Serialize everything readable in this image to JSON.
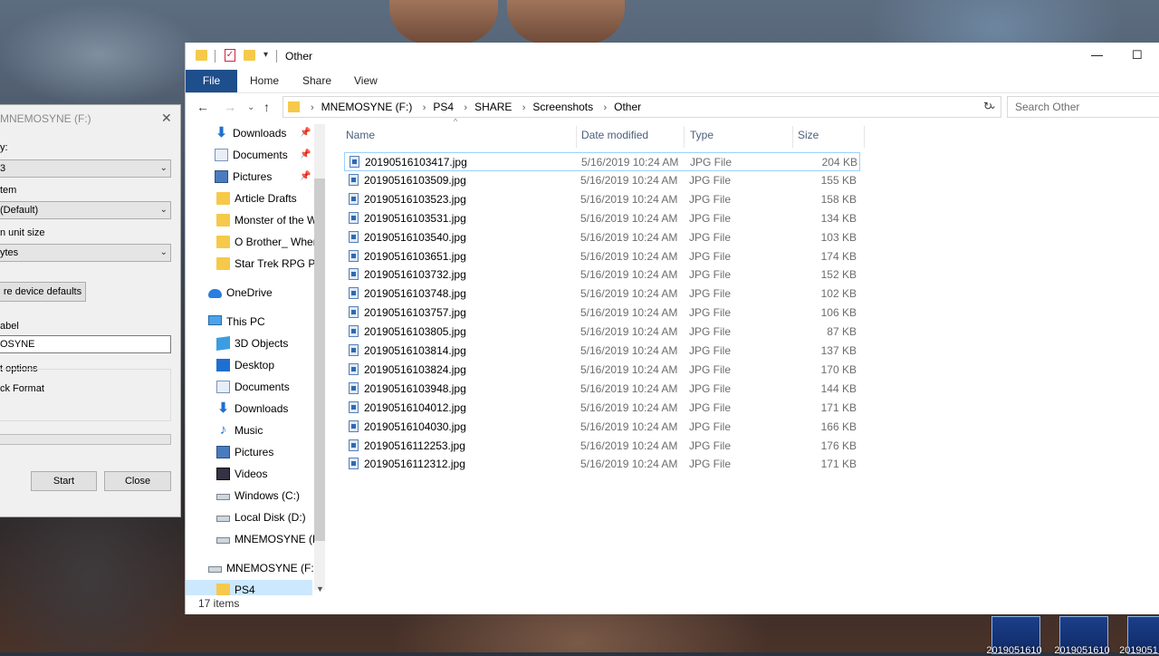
{
  "format_dialog": {
    "title": "MNEMOSYNE (F:)",
    "capacity_label": "y:",
    "capacity_value": "3",
    "filesystem_label": "tem",
    "filesystem_value": "(Default)",
    "allocation_label": "n unit size",
    "allocation_value": "ytes",
    "restore_button": "re device defaults",
    "volume_label_caption": "abel",
    "volume_label_value": "OSYNE",
    "format_options_caption": "t options",
    "quick_format_label": "ck Format",
    "start_button": "Start",
    "close_button": "Close"
  },
  "window": {
    "title": "Other",
    "minimize": "—",
    "maximize": "☐"
  },
  "ribbon_tabs": [
    "File",
    "Home",
    "Share",
    "View"
  ],
  "address": {
    "crumbs": [
      "MNEMOSYNE (F:)",
      "PS4",
      "SHARE",
      "Screenshots",
      "Other"
    ],
    "search_placeholder": "Search Other"
  },
  "nav_pane": [
    {
      "label": "Downloads",
      "icon": "download-icon",
      "pinned": true
    },
    {
      "label": "Documents",
      "icon": "document-icon",
      "pinned": true
    },
    {
      "label": "Pictures",
      "icon": "pictures-icon",
      "pinned": true
    },
    {
      "label": "Article Drafts",
      "icon": "folder-icon",
      "pinned": false
    },
    {
      "label": "Monster of the W",
      "icon": "folder-icon",
      "pinned": false
    },
    {
      "label": "O Brother_ Wher",
      "icon": "folder-icon",
      "pinned": false
    },
    {
      "label": "Star Trek RPG Pe",
      "icon": "folder-icon",
      "pinned": false
    },
    {
      "label": "OneDrive",
      "icon": "onedrive-icon",
      "pinned": false
    },
    {
      "label": "This PC",
      "icon": "this-pc-icon",
      "pinned": false
    },
    {
      "label": "3D Objects",
      "icon": "3d-objects-icon",
      "pinned": false
    },
    {
      "label": "Desktop",
      "icon": "desktop-icon",
      "pinned": false
    },
    {
      "label": "Documents",
      "icon": "document-icon",
      "pinned": false
    },
    {
      "label": "Downloads",
      "icon": "download-icon",
      "pinned": false
    },
    {
      "label": "Music",
      "icon": "music-icon",
      "pinned": false
    },
    {
      "label": "Pictures",
      "icon": "pictures-icon",
      "pinned": false
    },
    {
      "label": "Videos",
      "icon": "videos-icon",
      "pinned": false
    },
    {
      "label": "Windows (C:)",
      "icon": "drive-icon",
      "pinned": false
    },
    {
      "label": "Local Disk (D:)",
      "icon": "drive-icon",
      "pinned": false
    },
    {
      "label": "MNEMOSYNE (F:",
      "icon": "drive-icon",
      "pinned": false
    },
    {
      "label": "MNEMOSYNE (F:)",
      "icon": "drive-icon",
      "pinned": false
    },
    {
      "label": "PS4",
      "icon": "folder-icon",
      "pinned": false
    }
  ],
  "columns": {
    "name": "Name",
    "date": "Date modified",
    "type": "Type",
    "size": "Size"
  },
  "files": [
    {
      "name": "20190516103417.jpg",
      "date": "5/16/2019 10:24 AM",
      "type": "JPG File",
      "size": "204 KB"
    },
    {
      "name": "20190516103509.jpg",
      "date": "5/16/2019 10:24 AM",
      "type": "JPG File",
      "size": "155 KB"
    },
    {
      "name": "20190516103523.jpg",
      "date": "5/16/2019 10:24 AM",
      "type": "JPG File",
      "size": "158 KB"
    },
    {
      "name": "20190516103531.jpg",
      "date": "5/16/2019 10:24 AM",
      "type": "JPG File",
      "size": "134 KB"
    },
    {
      "name": "20190516103540.jpg",
      "date": "5/16/2019 10:24 AM",
      "type": "JPG File",
      "size": "103 KB"
    },
    {
      "name": "20190516103651.jpg",
      "date": "5/16/2019 10:24 AM",
      "type": "JPG File",
      "size": "174 KB"
    },
    {
      "name": "20190516103732.jpg",
      "date": "5/16/2019 10:24 AM",
      "type": "JPG File",
      "size": "152 KB"
    },
    {
      "name": "20190516103748.jpg",
      "date": "5/16/2019 10:24 AM",
      "type": "JPG File",
      "size": "102 KB"
    },
    {
      "name": "20190516103757.jpg",
      "date": "5/16/2019 10:24 AM",
      "type": "JPG File",
      "size": "106 KB"
    },
    {
      "name": "20190516103805.jpg",
      "date": "5/16/2019 10:24 AM",
      "type": "JPG File",
      "size": "87 KB"
    },
    {
      "name": "20190516103814.jpg",
      "date": "5/16/2019 10:24 AM",
      "type": "JPG File",
      "size": "137 KB"
    },
    {
      "name": "20190516103824.jpg",
      "date": "5/16/2019 10:24 AM",
      "type": "JPG File",
      "size": "170 KB"
    },
    {
      "name": "20190516103948.jpg",
      "date": "5/16/2019 10:24 AM",
      "type": "JPG File",
      "size": "144 KB"
    },
    {
      "name": "20190516104012.jpg",
      "date": "5/16/2019 10:24 AM",
      "type": "JPG File",
      "size": "171 KB"
    },
    {
      "name": "20190516104030.jpg",
      "date": "5/16/2019 10:24 AM",
      "type": "JPG File",
      "size": "166 KB"
    },
    {
      "name": "20190516112253.jpg",
      "date": "5/16/2019 10:24 AM",
      "type": "JPG File",
      "size": "176 KB"
    },
    {
      "name": "20190516112312.jpg",
      "date": "5/16/2019 10:24 AM",
      "type": "JPG File",
      "size": "171 KB"
    }
  ],
  "status": "17 items",
  "desktop_icons": [
    "2019051610",
    "2019051610",
    "2019051"
  ],
  "colors": {
    "file_tab": "#1e4e8c",
    "selection": "#cce8ff",
    "column_header_text": "#4c607a"
  }
}
